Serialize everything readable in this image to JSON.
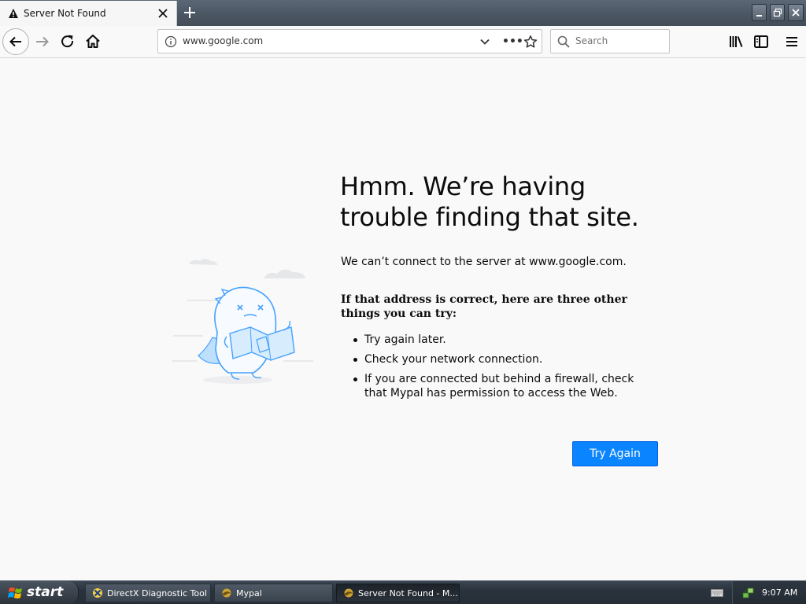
{
  "tab": {
    "title": "Server Not Found"
  },
  "address_bar": {
    "url": "www.google.com",
    "more_label": "•••"
  },
  "search": {
    "placeholder": "Search"
  },
  "error": {
    "title": "Hmm. We’re having trouble finding that site.",
    "description": "We can’t connect to the server at www.google.com.",
    "suggestions_heading": "If that address is correct, here are three other things you can try:",
    "suggestions": [
      "Try again later.",
      "Check your network connection.",
      "If you are connected but behind a firewall, check that Mypal has permission to access the Web."
    ],
    "try_again_label": "Try Again"
  },
  "taskbar": {
    "start_label": "start",
    "tasks": [
      {
        "label": "DirectX Diagnostic Tool"
      },
      {
        "label": "Mypal"
      },
      {
        "label": "Server Not Found - M..."
      }
    ],
    "clock": "9:07 AM"
  },
  "colors": {
    "accent": "#0a84ff",
    "page_background": "#f9f9fa",
    "illustration": "#45a1ff"
  },
  "icons": [
    "warning-icon",
    "close-icon",
    "new-tab-icon",
    "back-icon",
    "forward-icon",
    "reload-icon",
    "home-icon",
    "info-icon",
    "chevron-down-icon",
    "star-icon",
    "search-icon",
    "library-icon",
    "sidebar-icon",
    "menu-icon",
    "windows-flag-icon",
    "keyboard-icon"
  ]
}
